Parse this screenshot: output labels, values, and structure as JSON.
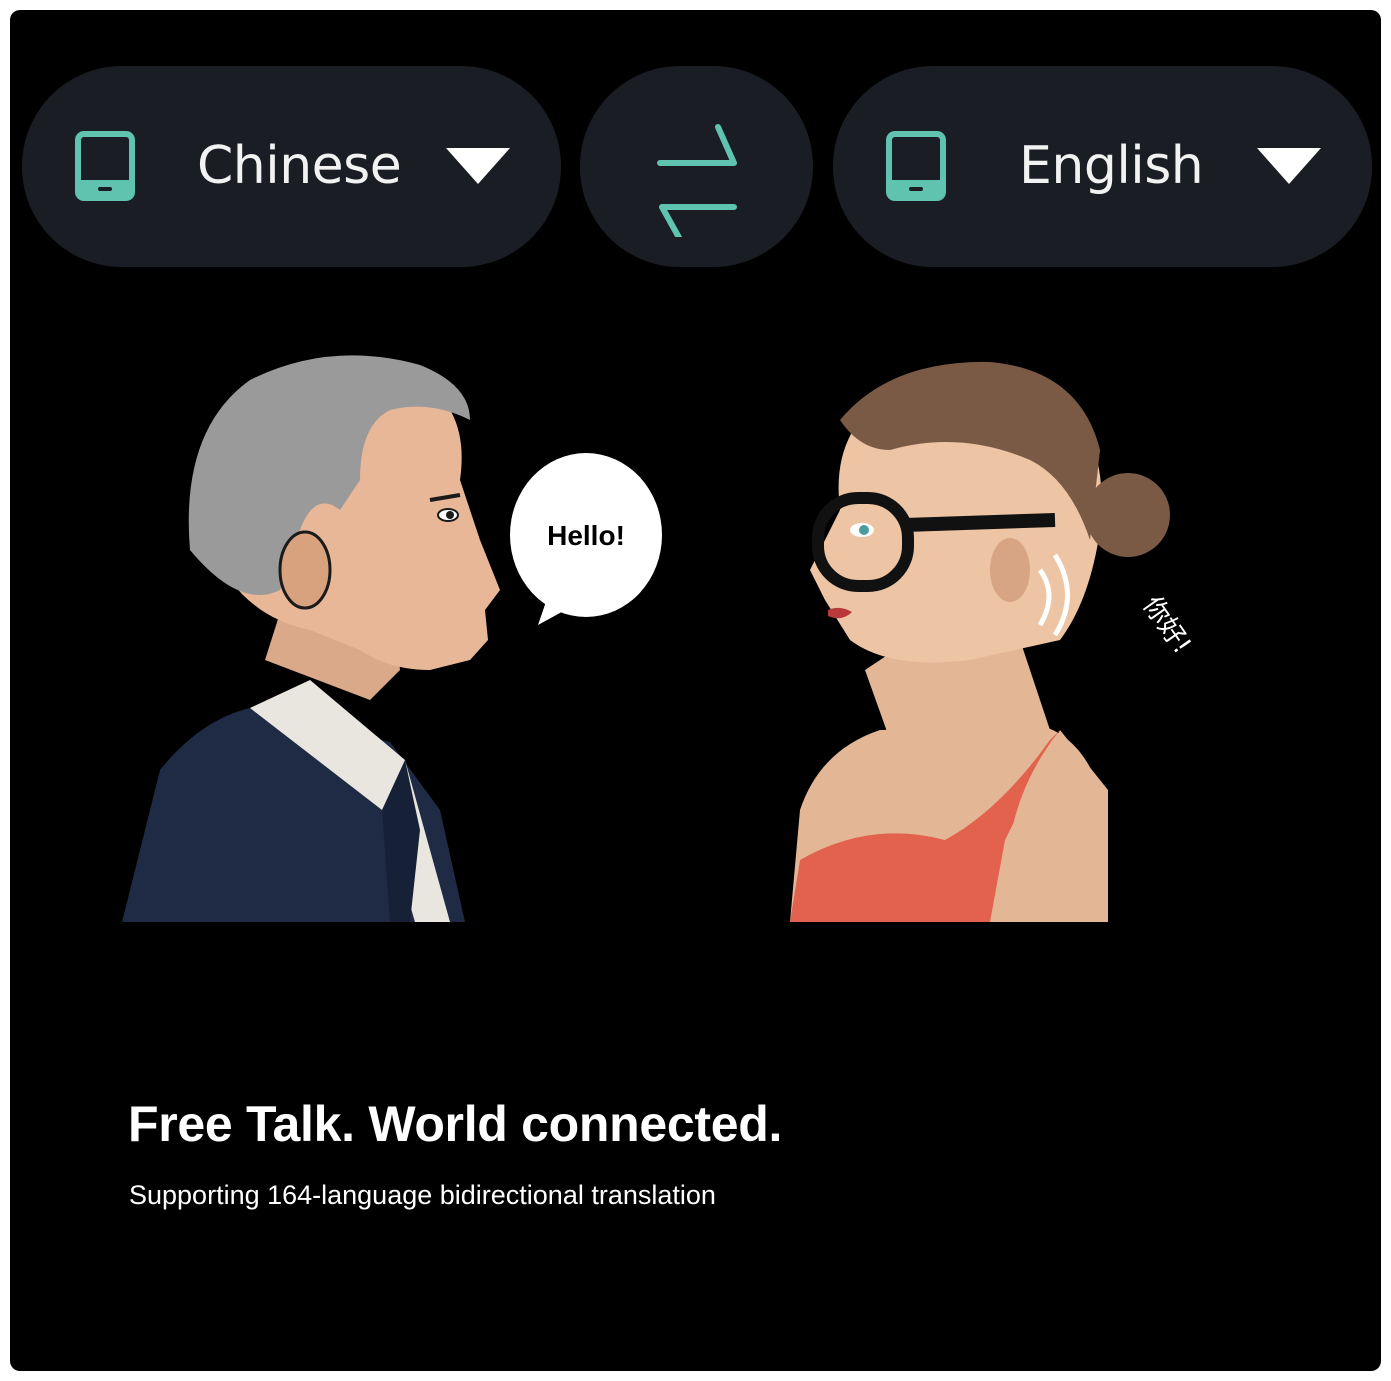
{
  "source_language": {
    "label": "Chinese",
    "icon": "phone-device-icon",
    "dropdown_icon": "caret-down-icon"
  },
  "swap": {
    "icon": "swap-arrows-icon"
  },
  "target_language": {
    "label": "English",
    "icon": "phone-device-icon",
    "dropdown_icon": "caret-down-icon"
  },
  "illustration": {
    "speech_bubble_text": "Hello!",
    "translated_text": "你好!"
  },
  "headline": "Free Talk. World connected.",
  "subline": "Supporting 164-language bidirectional translation",
  "colors": {
    "background": "#000000",
    "pill": "#1a1d23",
    "accent": "#5fc3b0",
    "text": "#ffffff"
  }
}
